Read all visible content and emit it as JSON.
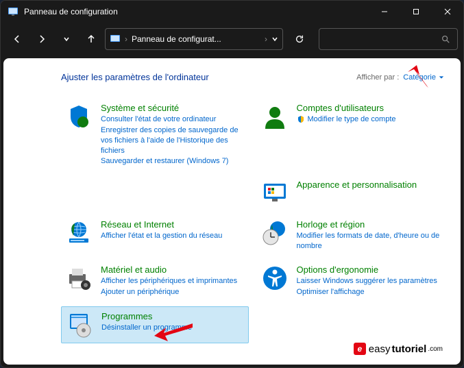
{
  "window": {
    "title": "Panneau de configuration"
  },
  "navbar": {
    "breadcrumb": "Panneau de configurat..."
  },
  "header": {
    "title": "Ajuster les paramètres de l'ordinateur",
    "view_by_label": "Afficher par :",
    "view_by_value": "Catégorie"
  },
  "categories": {
    "system": {
      "title": "Système et sécurité",
      "links": [
        "Consulter l'état de votre ordinateur",
        "Enregistrer des copies de sauvegarde de vos fichiers à l'aide de l'Historique des fichiers",
        "Sauvegarder et restaurer (Windows 7)"
      ]
    },
    "accounts": {
      "title": "Comptes d'utilisateurs",
      "link": "Modifier le type de compte"
    },
    "network": {
      "title": "Réseau et Internet",
      "link": "Afficher l'état et la gestion du réseau"
    },
    "appearance": {
      "title": "Apparence et personnalisation"
    },
    "hardware": {
      "title": "Matériel et audio",
      "links": [
        "Afficher les périphériques et imprimantes",
        "Ajouter un périphérique"
      ]
    },
    "clock": {
      "title": "Horloge et région",
      "link": "Modifier les formats de date, d'heure ou de nombre"
    },
    "ergonomics": {
      "title": "Options d'ergonomie",
      "links": [
        "Laisser Windows suggérer les paramètres",
        "Optimiser l'affichage"
      ]
    },
    "programs": {
      "title": "Programmes",
      "link": "Désinstaller un programme"
    }
  },
  "watermark": {
    "badge": "e",
    "text1": "easy",
    "text2": "tutoriel",
    "suffix": ".com"
  }
}
